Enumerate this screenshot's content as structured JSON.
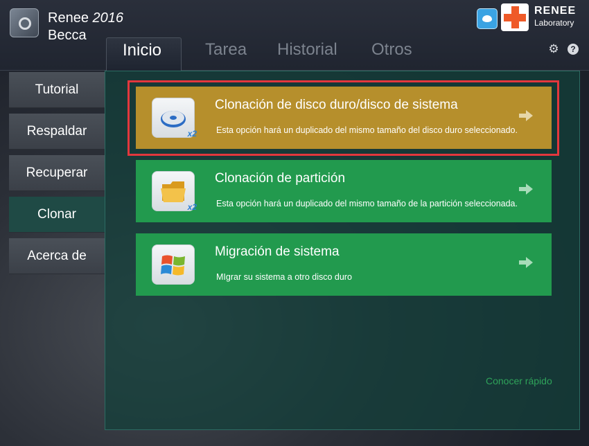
{
  "app": {
    "name": "Renee",
    "version": "2016",
    "product": "Becca"
  },
  "tabs": [
    {
      "label": "Inicio",
      "active": true
    },
    {
      "label": "Tarea",
      "active": false
    },
    {
      "label": "Historial",
      "active": false
    },
    {
      "label": "Otros",
      "active": false
    }
  ],
  "brand": {
    "name": "RENEE",
    "sub": "Laboratory"
  },
  "header_icons": [
    "twitter-icon",
    "renee-logo-icon",
    "gear-icon",
    "help-icon"
  ],
  "sidebar": {
    "items": [
      {
        "label": "Tutorial",
        "active": false
      },
      {
        "label": "Respaldar",
        "active": false
      },
      {
        "label": "Recuperar",
        "active": false
      },
      {
        "label": "Clonar",
        "active": true
      },
      {
        "label": "Acerca de",
        "active": false
      }
    ]
  },
  "cards": [
    {
      "title": "Clonación de disco duro/disco de sistema",
      "description": "Esta opción hará un duplicado del mismo tamaño del disco duro seleccionado.",
      "icon": "hard-disk-clone-icon",
      "badge": "x2",
      "color": "#b68f2c",
      "selected": true
    },
    {
      "title": "Clonación de partición",
      "description": "Esta opción hará un duplicado del mismo tamaño de la partición seleccionada.",
      "icon": "partition-folder-clone-icon",
      "badge": "x2",
      "color": "#229a4e",
      "selected": false
    },
    {
      "title": "Migración de sistema",
      "description": "MIgrar su sistema a otro disco duro",
      "icon": "windows-logo-icon",
      "badge": "",
      "color": "#229a4e",
      "selected": false
    }
  ],
  "quick_link": "Conocer rápido",
  "colors": {
    "accent_green": "#229a4e",
    "selected_gold": "#b68f2c",
    "highlight_red": "#e3373d"
  }
}
